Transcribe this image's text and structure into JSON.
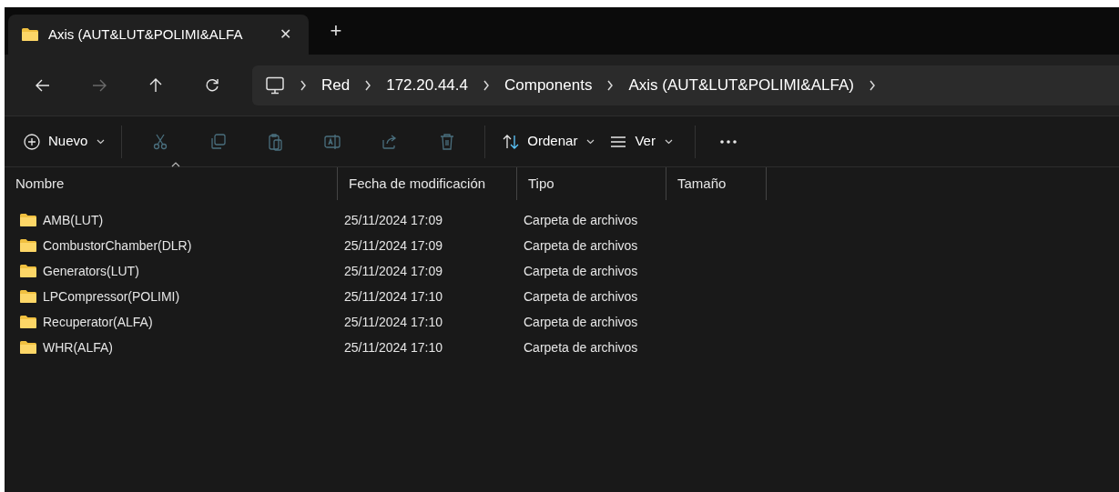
{
  "tabs": [
    {
      "label": "Axis (AUT&LUT&POLIMI&ALFA",
      "selected": true,
      "close": "✕"
    }
  ],
  "new_tab": "+",
  "nav": [
    {
      "kind": "back",
      "disabled": false
    },
    {
      "kind": "forward",
      "disabled": true
    },
    {
      "kind": "up",
      "disabled": false
    },
    {
      "kind": "refresh",
      "disabled": false
    }
  ],
  "breadcrumb": [
    "Red",
    "172.20.44.4",
    "Components",
    "Axis (AUT&LUT&POLIMI&ALFA)"
  ],
  "toolbar": [
    {
      "kind": "new",
      "label": "Nuevo",
      "disabled": false
    },
    {
      "kind": "cut",
      "disabled": true
    },
    {
      "kind": "copy",
      "disabled": true
    },
    {
      "kind": "paste",
      "disabled": true
    },
    {
      "kind": "rename",
      "disabled": true
    },
    {
      "kind": "share",
      "disabled": true
    },
    {
      "kind": "delete",
      "disabled": true
    },
    {
      "kind": "sort",
      "label": "Ordenar",
      "disabled": false
    },
    {
      "kind": "view",
      "label": "Ver",
      "disabled": false
    },
    {
      "kind": "more",
      "disabled": false
    }
  ],
  "columns": [
    "Nombre",
    "Fecha de modificación",
    "Tipo",
    "Tamaño"
  ],
  "rows": [
    {
      "name": "AMB(LUT)",
      "date": "25/11/2024 17:09",
      "type": "Carpeta de archivos"
    },
    {
      "name": "CombustorChamber(DLR)",
      "date": "25/11/2024 17:09",
      "type": "Carpeta de archivos"
    },
    {
      "name": "Generators(LUT)",
      "date": "25/11/2024 17:09",
      "type": "Carpeta de archivos"
    },
    {
      "name": "LPCompressor(POLIMI)",
      "date": "25/11/2024 17:10",
      "type": "Carpeta de archivos"
    },
    {
      "name": "Recuperator(ALFA)",
      "date": "25/11/2024 17:10",
      "type": "Carpeta de archivos"
    },
    {
      "name": "WHR(ALFA)",
      "date": "25/11/2024 17:10",
      "type": "Carpeta de archivos"
    }
  ]
}
